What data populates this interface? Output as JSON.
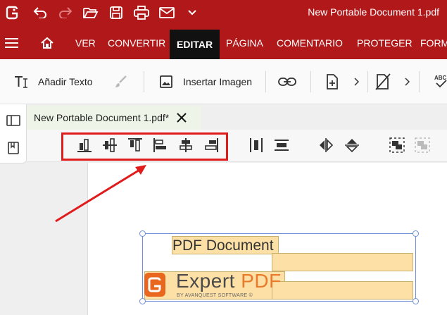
{
  "window": {
    "title": "New Portable Document 1.pdf"
  },
  "quick_access": [
    "app-logo-icon",
    "undo-icon",
    "redo-icon",
    "open-folder-icon",
    "save-icon",
    "print-icon",
    "mail-icon",
    "chevron-down-icon"
  ],
  "menu": {
    "items": [
      "VER",
      "CONVERTIR",
      "EDITAR",
      "PÁGINA",
      "COMENTARIO",
      "PROTEGER",
      "FORM"
    ],
    "active": "EDITAR"
  },
  "ribbon": {
    "add_text": "Añadir Texto",
    "insert_image": "Insertar Imagen"
  },
  "document_tab": {
    "label": "New Portable Document 1.pdf*"
  },
  "page_content": {
    "line1": "PDF Document",
    "brand_part1": "Expert ",
    "brand_part2": "PDF",
    "brand_sub": "BY AVANQUEST SOFTWARE ©"
  },
  "colors": {
    "brand_red": "#b0181a",
    "highlight_box": "#e01b1b",
    "highlight_fill": "#fde0a6",
    "logo_orange": "#e9661e"
  }
}
